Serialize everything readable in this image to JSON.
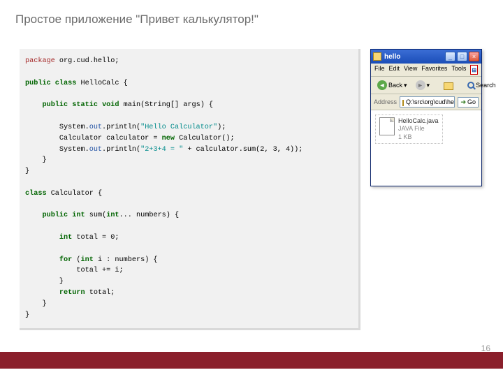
{
  "slide": {
    "title": "Простое приложение \"Привет калькулятор!\"",
    "page_number": "16"
  },
  "code": {
    "l01_pkg": "package",
    "l01_name": " org.cud.hello;",
    "l02_public": "public",
    "l02_class": " class",
    "l02_name": " HelloCalc {",
    "l03_public": "public",
    "l03_static": " static",
    "l03_void": " void",
    "l03_rest": " main(String[] args) {",
    "l04a": "        System.",
    "l04_out": "out",
    "l04b": ".println(",
    "l04_str": "\"Hello Calculator\"",
    "l04c": ");",
    "l05a": "        Calculator calculator = ",
    "l05_new": "new",
    "l05b": " Calculator();",
    "l06a": "        System.",
    "l06_out": "out",
    "l06b": ".println(",
    "l06_str": "\"2+3+4 = \"",
    "l06c": " + calculator.sum(2, 3, 4));",
    "l07": "    }",
    "l08": "}",
    "l09_class": "class",
    "l09_name": " Calculator {",
    "l10_public": "public",
    "l10_int": " int",
    "l10_rest": " sum(",
    "l10_int2": "int",
    "l10_rest2": "... numbers) {",
    "l11_int": "int",
    "l11_rest": " total = 0;",
    "l12_for": "for",
    "l12_paren": " (",
    "l12_int": "int",
    "l12_rest": " i : numbers) {",
    "l13": "            total += i;",
    "l14": "        }",
    "l15_return": "return",
    "l15_rest": " total;",
    "l16": "    }",
    "l17": "}"
  },
  "explorer": {
    "title": "hello",
    "menu": {
      "file": "File",
      "edit": "Edit",
      "view": "View",
      "favorites": "Favorites",
      "tools": "Tools"
    },
    "toolbar": {
      "back": "Back",
      "search": "Search"
    },
    "address": {
      "label": "Address",
      "path": "Q:\\src\\org\\cud\\hello",
      "go": "Go"
    },
    "file": {
      "name": "HelloCalc.java",
      "type": "JAVA File",
      "size": "1 KB"
    }
  }
}
